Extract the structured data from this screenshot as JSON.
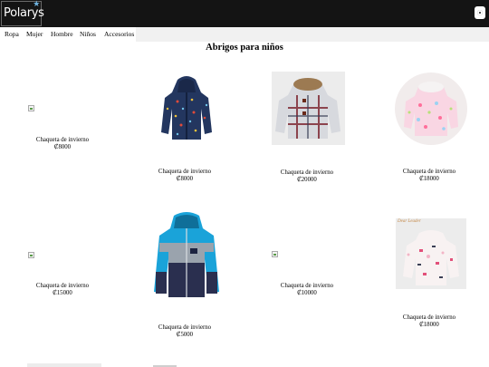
{
  "header": {
    "logo_text": "Polarys",
    "logo_star": "★"
  },
  "nav": {
    "items": [
      "Ropa",
      "Mujer",
      "Hombre",
      "Niños",
      "Accesorios"
    ]
  },
  "main": {
    "title": "Abrigos para niños",
    "products": [
      {
        "name": "Chaqueta de invierno",
        "price": "₡8000"
      },
      {
        "name": "Chaqueta de invierno",
        "price": "₡8000"
      },
      {
        "name": "Chaqueta de invierno",
        "price": "₡20000"
      },
      {
        "name": "Chaqueta de invierno",
        "price": "₡18000"
      },
      {
        "name": "Chaqueta de invierno",
        "price": "₡15000"
      },
      {
        "name": "Chaqueta de invierno",
        "price": "₡5000"
      },
      {
        "name": "Chaqueta de invierno",
        "price": "₡10000"
      },
      {
        "name": "Chaqueta de invierno",
        "price": "₡18000",
        "image_text": "Dear Leader"
      }
    ]
  },
  "colors": {
    "topbar": "#141414",
    "navstrip": "#f1f1f1"
  }
}
